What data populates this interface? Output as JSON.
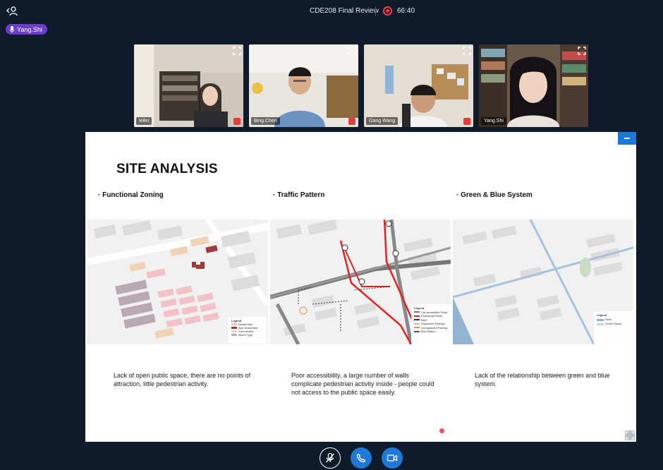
{
  "header": {
    "meeting_title": "CDE208 Final Review",
    "timer": "66:40",
    "speaker": "Yang.Shi"
  },
  "participants": [
    {
      "name": "leilei",
      "muted": true
    },
    {
      "name": "Bing.Chen",
      "muted": true
    },
    {
      "name": "Gang Wang",
      "muted": true
    },
    {
      "name": "Yang.Shi",
      "muted": false
    }
  ],
  "slide": {
    "title": "SITE ANALYSIS",
    "sections": [
      {
        "heading": "· Functional Zoning",
        "caption": "Lack of open public space, there are no points of attraction, little pedestrian activity.",
        "legend": {
          "title": "Legend",
          "items": [
            "Residential",
            "Non-residential",
            "Commercial",
            "Mixed Type"
          ]
        }
      },
      {
        "heading": "· Traffic Pattern",
        "caption": "Poor accessibility, a large number of walls complicate pedestrian activity inside - people could not access to the public space easily.",
        "legend": {
          "title": "Legend",
          "items": [
            "Car-accessible Road",
            "Pedestrian Road",
            "Wall",
            "Organized Parking",
            "Unorganized Parking",
            "Bus Station"
          ]
        }
      },
      {
        "heading": "· Green & Blue System",
        "caption": "Lack of the relationship between green and blue system.",
        "legend": {
          "title": "Legend",
          "items": [
            "River",
            "Green Space"
          ]
        }
      }
    ]
  },
  "colors": {
    "background": "#0f1b2b",
    "accent_blue": "#1e78d7",
    "record_red": "#ff3b45",
    "speaker_purple": "#6e3ccc"
  },
  "controls": {
    "mute_icon": "mic-off-icon",
    "call_icon": "phone-icon",
    "video_icon": "video-camera-icon"
  }
}
